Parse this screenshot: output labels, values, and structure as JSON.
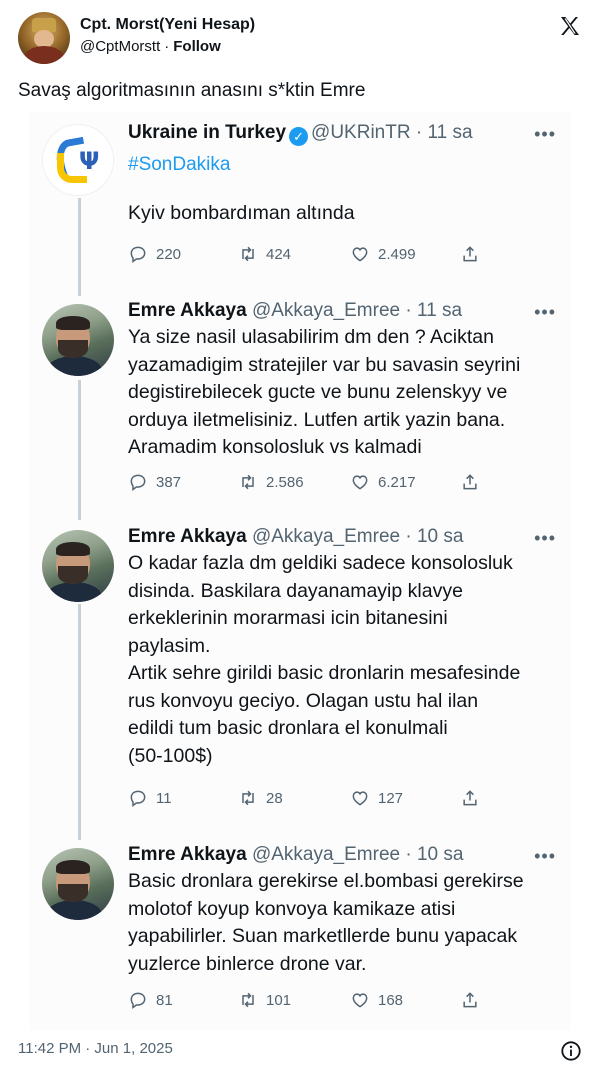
{
  "outer": {
    "author_name": "Cpt. Morst(Yeni Hesap)",
    "author_handle": "@CptMorstt",
    "separator": "·",
    "follow_label": "Follow",
    "text": "Savaş algoritmasının anasını s*ktin Emre",
    "timestamp": "11:42 PM · Jun 1, 2025"
  },
  "thread": [
    {
      "name": "Ukraine in Turkey",
      "handle": "@UKRinTR",
      "time": "· 11 sa",
      "hashtag": "#SonDakika",
      "body": "Kyiv bombardıman altında",
      "replies": "220",
      "retweets": "424",
      "likes": "2.499",
      "verified": true
    },
    {
      "name": "Emre Akkaya",
      "handle": "@Akkaya_Emree",
      "time": "· 11 sa",
      "body": "Ya size nasil ulasabilirim dm den ? Aciktan\nyazamadigim stratejiler var bu savasin seyrini\ndegistirebilecek gucte ve bunu zelenskyy ve\norduya iletmelisiniz. Lutfen artik yazin bana.\nAramadim konsolosluk vs kalmadi",
      "replies": "387",
      "retweets": "2.586",
      "likes": "6.217"
    },
    {
      "name": "Emre Akkaya",
      "handle": "@Akkaya_Emree",
      "time": "· 10 sa",
      "body": "O kadar fazla dm geldiki sadece konsolosluk\ndisinda. Baskilara dayanamayip klavye\nerkeklerinin morarmasi icin bitanesini\npaylasim.\nArtik sehre girildi basic dronlarin mesafesinde\nrus konvoyu geciyo. Olagan ustu hal ilan\nedildi tum basic dronlara el konulmali\n(50-100$)",
      "replies": "11",
      "retweets": "28",
      "likes": "127"
    },
    {
      "name": "Emre Akkaya",
      "handle": "@Akkaya_Emree",
      "time": "· 10 sa",
      "body": "Basic dronlara gerekirse el.bombasi gerekirse\nmolotof koyup konvoya kamikaze atisi\nyapabilirler. Suan marketllerde bunu yapacak\nyuzlerce binlerce drone var.",
      "replies": "81",
      "retweets": "101",
      "likes": "168"
    }
  ],
  "icons": {
    "x_logo": "x-logo-icon",
    "more": "more-dots-icon",
    "reply": "reply-icon",
    "retweet": "retweet-icon",
    "like": "heart-icon",
    "share": "share-icon",
    "info": "info-icon"
  },
  "colors": {
    "link_blue": "#1d9bf0",
    "muted": "#536471",
    "thread_line": "#c9d1d8"
  }
}
